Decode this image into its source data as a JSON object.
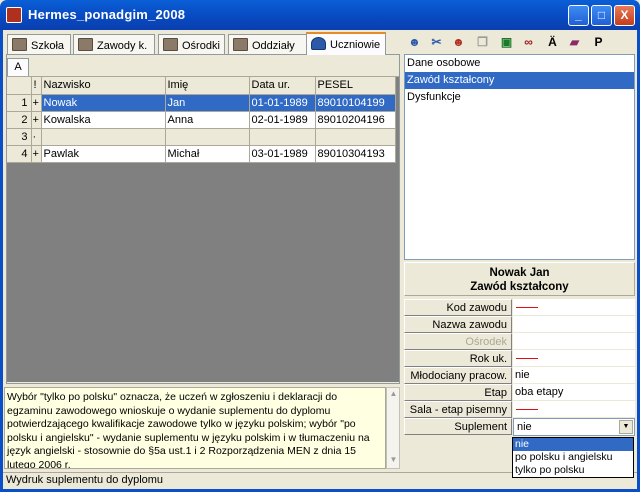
{
  "window": {
    "title": "Hermes_ponadgim_2008",
    "controls": [
      "_",
      "□",
      "X"
    ]
  },
  "tabs": [
    {
      "label": "Szkoła",
      "u": "S",
      "icon": "building-icon"
    },
    {
      "label": "Zawody k.",
      "u": "Z",
      "icon": "building-icon"
    },
    {
      "label": "Ośrodki",
      "u": "O",
      "icon": "building-icon"
    },
    {
      "label": "Oddziały",
      "u": "O",
      "icon": "classroom-icon"
    },
    {
      "label": "Uczniowie",
      "u": "U",
      "icon": "students-icon"
    }
  ],
  "toolbar": {
    "items": [
      "person-icon",
      "cut-person-icon",
      "group-icon",
      "copy-icon",
      "save-icon",
      "binoculars-icon",
      "a-umlaut-icon",
      "book-icon",
      "p-icon"
    ],
    "a_glyph": "Ä",
    "p_glyph": "P"
  },
  "grid": {
    "subtab": "A",
    "columns": [
      "!",
      "Nazwisko",
      "Imię",
      "Data ur.",
      "PESEL"
    ],
    "rows": [
      {
        "n": "1",
        "mark": "+",
        "nazwisko": "Nowak",
        "imie": "Jan",
        "data": "01-01-1989",
        "pesel": "89010104199",
        "selected": true
      },
      {
        "n": "2",
        "mark": "+",
        "nazwisko": "Kowalska",
        "imie": "Anna",
        "data": "02-01-1989",
        "pesel": "89010204196"
      },
      {
        "n": "3",
        "mark": "·",
        "nazwisko": "",
        "imie": "",
        "data": "",
        "pesel": ""
      },
      {
        "n": "4",
        "mark": "+",
        "nazwisko": "Pawlak",
        "imie": "Michał",
        "data": "03-01-1989",
        "pesel": "89010304193"
      }
    ]
  },
  "info": {
    "text": "Wybór \"tylko po polsku\" oznacza, że uczeń w zgłoszeniu i deklaracji do egzaminu zawodowego wnioskuje o wydanie suplementu do dyplomu potwierdzającego kwalifikacje zawodowe tylko w języku polskim; wybór \"po polsku i angielsku\" - wydanie suplementu w języku polskim i w tłumaczeniu na język angielski - stosownie do §5a ust.1 i 2 Rozporządzenia MEN z dnia 15 lutego 2006 r."
  },
  "status": {
    "text": "Wydruk suplementu do dyplomu"
  },
  "sections": {
    "items": [
      "Dane osobowe",
      "Zawód kształcony",
      "Dysfunkcje"
    ],
    "selected_index": 1
  },
  "detail": {
    "name": "Nowak Jan",
    "section": "Zawód kształcony",
    "fields": [
      {
        "label": "Kod zawodu",
        "value": "",
        "required": true
      },
      {
        "label": "Nazwa zawodu",
        "value": ""
      },
      {
        "label": "Ośrodek",
        "value": "",
        "disabled": true
      },
      {
        "label": "Rok uk.",
        "value": "",
        "required": true
      },
      {
        "label": "Młodociany pracow.",
        "value": "nie"
      },
      {
        "label": "Etap",
        "value": "oba etapy"
      },
      {
        "label": "Sala - etap pisemny",
        "value": "",
        "required": true
      },
      {
        "label": "Suplement",
        "value": "nie",
        "dropdown": true
      }
    ]
  },
  "dropdown": {
    "options": [
      "nie",
      "po polsku i angielsku",
      "tylko po polsku"
    ],
    "selected_index": 0
  }
}
